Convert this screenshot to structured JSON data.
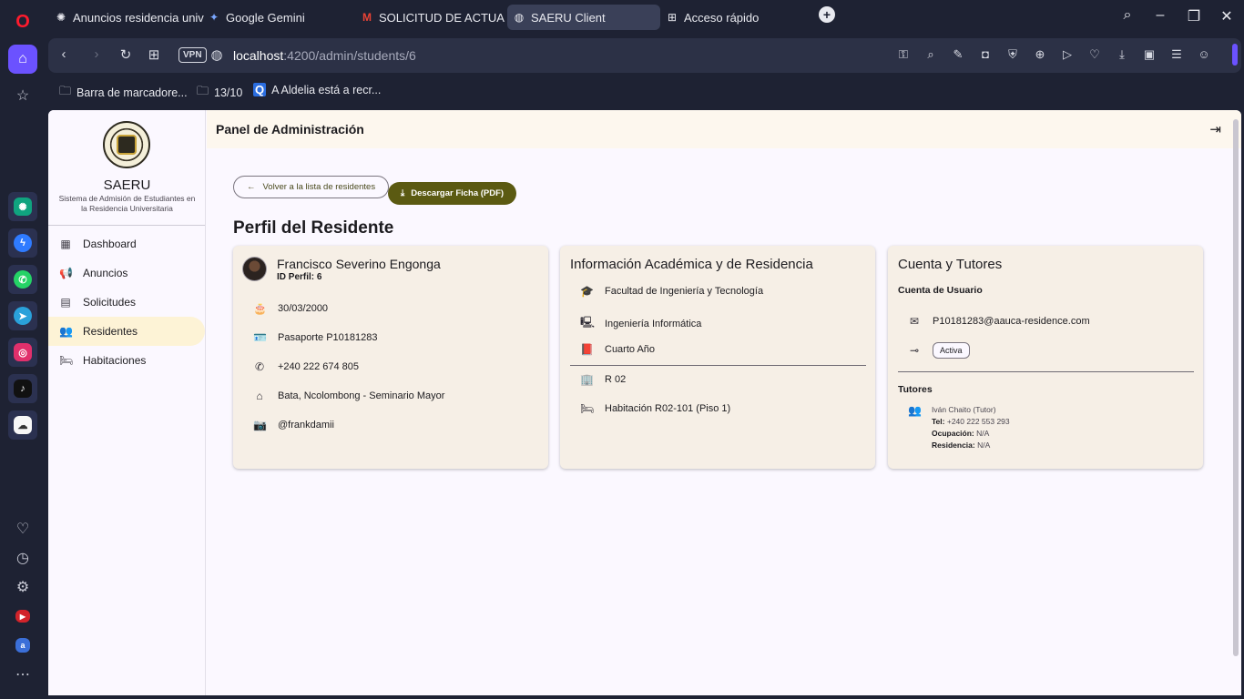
{
  "browser": {
    "tabs": [
      {
        "label": "Anuncios residencia unive",
        "icon": "openai-icon"
      },
      {
        "label": "Google Gemini",
        "icon": "gemini-icon"
      },
      {
        "label": "SOLICITUD DE ACTUALIZA",
        "icon": "gmail-icon"
      },
      {
        "label": "SAERU Client",
        "icon": "globe-icon",
        "active": true
      },
      {
        "label": "Acceso rápido",
        "icon": "grid-icon"
      }
    ],
    "url_host": "localhost",
    "url_rest": ":4200/admin/students/6",
    "vpn": "VPN",
    "bookmarks": [
      {
        "label": "Barra de marcadore...",
        "icon": "folder-icon"
      },
      {
        "label": "13/10",
        "icon": "folder-icon"
      },
      {
        "label": "A Aldelia está a recr...",
        "icon": "q-icon"
      }
    ]
  },
  "sidebar": {
    "brand": "SAERU",
    "subtitle": "Sistema de Admisión de Estudiantes en la Residencia Universitaria",
    "items": [
      {
        "label": "Dashboard",
        "icon": "dashboard-icon"
      },
      {
        "label": "Anuncios",
        "icon": "megaphone-icon"
      },
      {
        "label": "Solicitudes",
        "icon": "clipboard-icon"
      },
      {
        "label": "Residentes",
        "icon": "people-icon",
        "active": true
      },
      {
        "label": "Habitaciones",
        "icon": "bed-icon"
      }
    ]
  },
  "header": {
    "title": "Panel de Administración"
  },
  "actions": {
    "back_label": "Volver a la lista de residentes",
    "pdf_label": "Descargar Ficha (PDF)"
  },
  "page_title": "Perfil del Residente",
  "personal": {
    "name": "Francisco Severino Engonga",
    "id_label": "ID Perfil: 6",
    "birth": "30/03/2000",
    "document": "Pasaporte P10181283",
    "phone": "+240 222 674 805",
    "address": "Bata, Ncolombong - Seminario Mayor",
    "instagram": "@frankdamii"
  },
  "academic": {
    "title": "Información Académica y de Residencia",
    "faculty": "Facultad de Ingeniería y Tecnología",
    "career": "Ingeniería Informática",
    "year": "Cuarto Año",
    "residence": "R 02",
    "room": "Habitación R02-101 (Piso 1)"
  },
  "account": {
    "title": "Cuenta y Tutores",
    "user_heading": "Cuenta de Usuario",
    "email": "P10181283@aauca-residence.com",
    "status": "Activa",
    "tutors_heading": "Tutores",
    "tutor_name": "Iván Chaito (Tutor)",
    "tel_label": "Tel:",
    "tel_value": "+240 222 553 293",
    "occupation_label": "Ocupación:",
    "occupation_value": "N/A",
    "residence_label": "Residencia:",
    "residence_value": "N/A"
  },
  "colors": {
    "accent": "#5b5a12",
    "active_nav": "#fdf3d6",
    "card_bg": "#f6efe6",
    "browser_bg": "#1e2233",
    "opera_red": "#ff1b2d",
    "home_purple": "#6b52ff"
  }
}
